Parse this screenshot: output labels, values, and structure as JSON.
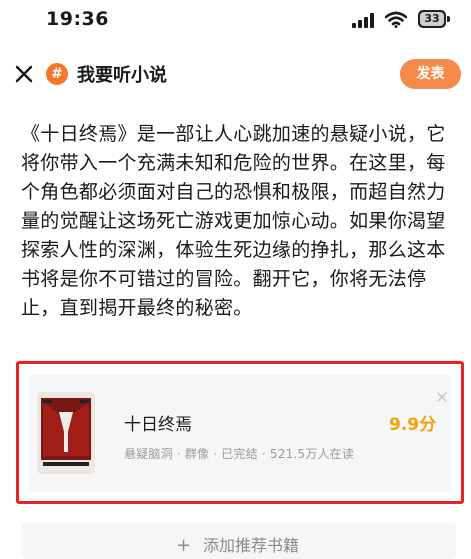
{
  "status_bar": {
    "time": "19:36",
    "battery": "33",
    "icons": [
      "signal-icon",
      "wifi-icon",
      "battery-icon"
    ]
  },
  "nav": {
    "close_icon": "close-icon",
    "topic_icon_glyph": "#",
    "title": "我要听小说",
    "publish_label": "发表"
  },
  "post": {
    "text": "《十日终焉》是一部让人心跳加速的悬疑小说，它将你带入一个充满未知和危险的世界。在这里，每个角色都必须面对自己的恐惧和极限，而超自然力量的觉醒让这场死亡游戏更加惊心动。如果你渴望探索人性的深渊，体验生死边缘的挣扎，那么这本书将是你不可错过的冒险。翻开它，你将无法停止，直到揭开最终的秘密。"
  },
  "book_card": {
    "title": "十日终焉",
    "rating": "9.9分",
    "meta": "悬疑脑洞 · 群像 · 已完结 · 521.5万人在读",
    "close_icon": "close-icon",
    "cover_icon": "book-cover-image"
  },
  "add_book": {
    "icon": "plus-icon",
    "label": "添加推荐书籍"
  },
  "colors": {
    "accent": "#f58a4b",
    "highlight_border": "#e6232a",
    "rating": "#f0a30a",
    "meta_text": "#9b9b9b"
  }
}
